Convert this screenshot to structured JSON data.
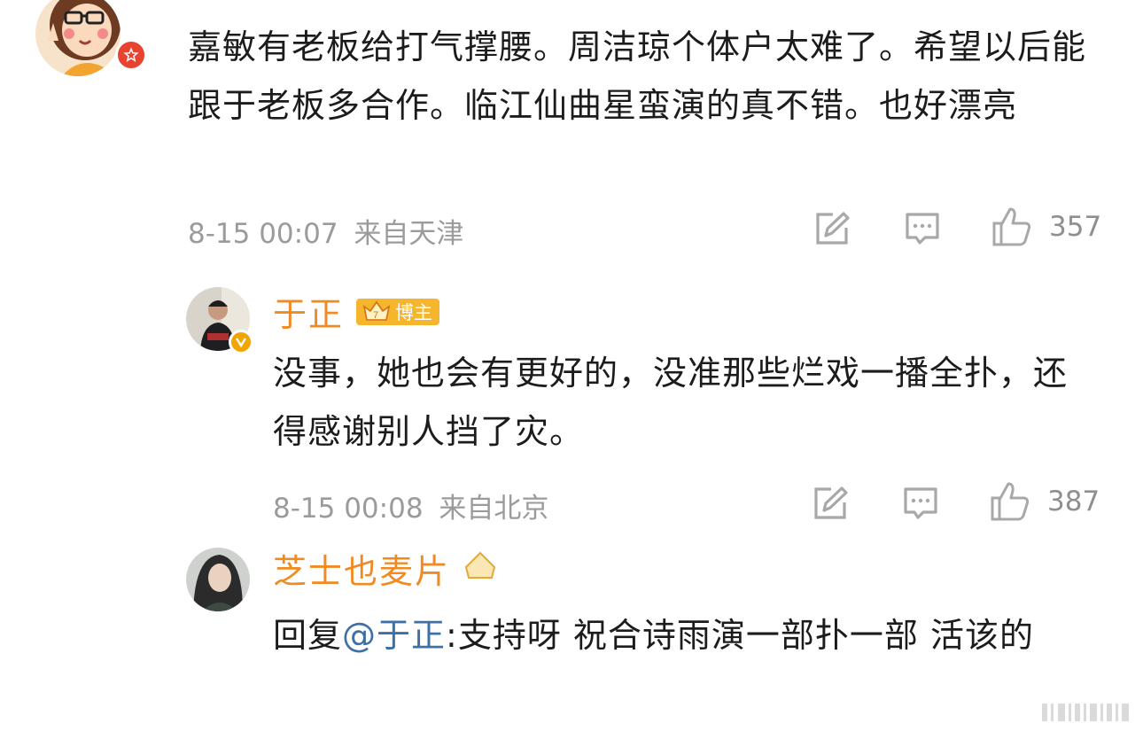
{
  "comments": [
    {
      "text": "嘉敏有老板给打气撑腰。周洁琼个体户太难了。希望以后能跟于老板多合作。临江仙曲星蛮演的真不错。也好漂亮",
      "time": "8-15 00:07",
      "location": "来自天津",
      "likes": "357"
    },
    {
      "username": "于正",
      "badge": "博主",
      "text": "没事，她也会有更好的，没准那些烂戏一播全扑，还得感谢别人挡了灾。",
      "time": "8-15 00:08",
      "location": "来自北京",
      "likes": "387"
    },
    {
      "username": "芝士也麦片",
      "reply_prefix": "回复",
      "mention": "@于正",
      "text": ":支持呀 祝合诗雨演一部扑一部 活该的"
    }
  ],
  "colors": {
    "username": "#f08a23",
    "mention": "#3d6fa8",
    "badge": "#f5b52c",
    "meta": "#9b9b9b"
  },
  "icons": [
    "share-edit-icon",
    "comment-icon",
    "like-thumb-icon",
    "verified-badge-icon",
    "crown-icon"
  ]
}
